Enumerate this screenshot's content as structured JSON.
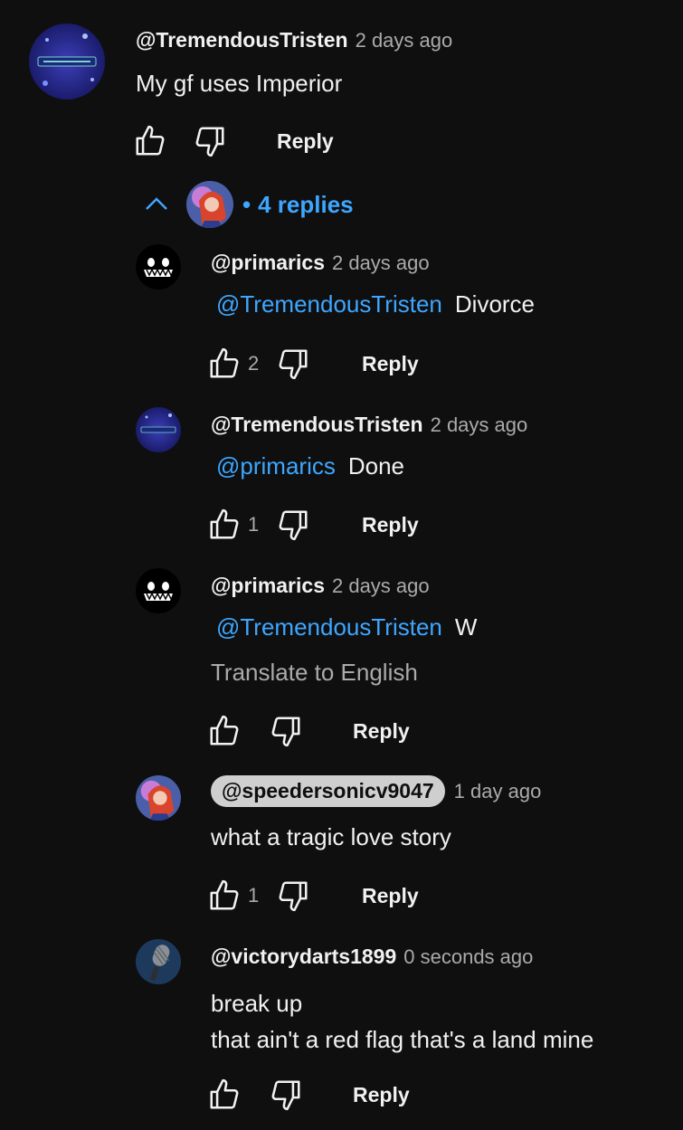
{
  "top_comment": {
    "author": "@TremendousTristen",
    "time": "2 days ago",
    "text": "My gf uses Imperior",
    "reply_label": "Reply"
  },
  "replies_toggle": {
    "dot": "•",
    "label": "4 replies"
  },
  "replies": [
    {
      "author": "@primarics",
      "time": "2 days ago",
      "mention": "@TremendousTristen",
      "text": "Divorce",
      "likes": "2",
      "reply_label": "Reply"
    },
    {
      "author": "@TremendousTristen",
      "time": "2 days ago",
      "mention": "@primarics",
      "text": "Done",
      "likes": "1",
      "reply_label": "Reply"
    },
    {
      "author": "@primarics",
      "time": "2 days ago",
      "mention": "@TremendousTristen",
      "text": "W",
      "translate": "Translate to English",
      "reply_label": "Reply"
    },
    {
      "author": "@speedersonicv9047",
      "time": "1 day ago",
      "text": "what a tragic love story",
      "likes": "1",
      "reply_label": "Reply"
    },
    {
      "author": "@victorydarts1899",
      "time": "0 seconds ago",
      "text_line1": "break up",
      "text_line2": "that ain't a red flag that's a land mine",
      "reply_label": "Reply"
    }
  ],
  "colors": {
    "background": "#0f0f0f",
    "link": "#3ea6ff",
    "secondary_text": "#aaaaaa",
    "primary_text": "#f1f1f1"
  },
  "icons": [
    "thumbs-up-icon",
    "thumbs-down-icon",
    "chevron-up-icon"
  ]
}
